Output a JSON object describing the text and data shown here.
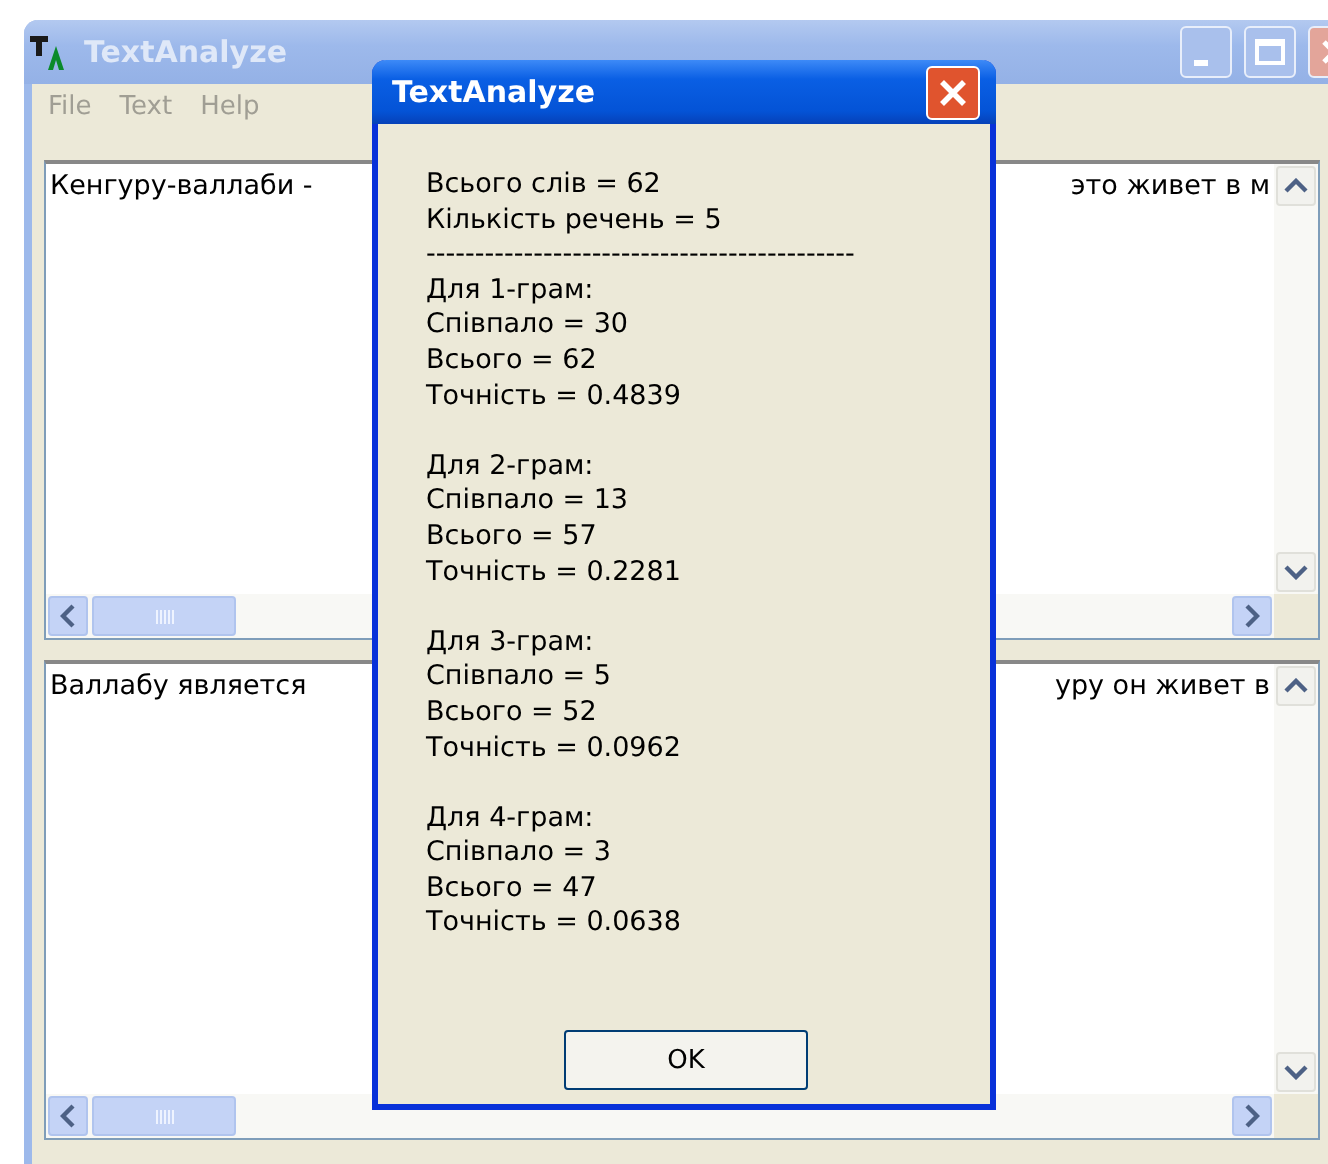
{
  "window": {
    "title": "TextAnalyze"
  },
  "menu": [
    "File",
    "Text",
    "Help"
  ],
  "memos": [
    {
      "text_start": "Кенгуру-валлаби -",
      "text_end": "это живет в м"
    },
    {
      "text_start": "Валлабу является",
      "text_end": "уру он живет в"
    }
  ],
  "dialog": {
    "title": "TextAnalyze",
    "summary": [
      "Всього слів = 62",
      "Кількість речень = 5"
    ],
    "separator": "--------------------------------------------",
    "blocks": [
      {
        "heading": "Для 1-грам:",
        "lines": [
          "Співпало = 30",
          "Всього = 62",
          "Точність = 0.4839"
        ]
      },
      {
        "heading": "Для 2-грам:",
        "lines": [
          "Співпало = 13",
          "Всього = 57",
          "Точність = 0.2281"
        ]
      },
      {
        "heading": "Для 3-грам:",
        "lines": [
          "Співпало = 5",
          "Всього = 52",
          "Точність = 0.0962"
        ]
      },
      {
        "heading": "Для 4-грам:",
        "lines": [
          "Співпало = 3",
          "Всього = 47",
          "Точність = 0.0638"
        ]
      }
    ],
    "button": "OK"
  }
}
